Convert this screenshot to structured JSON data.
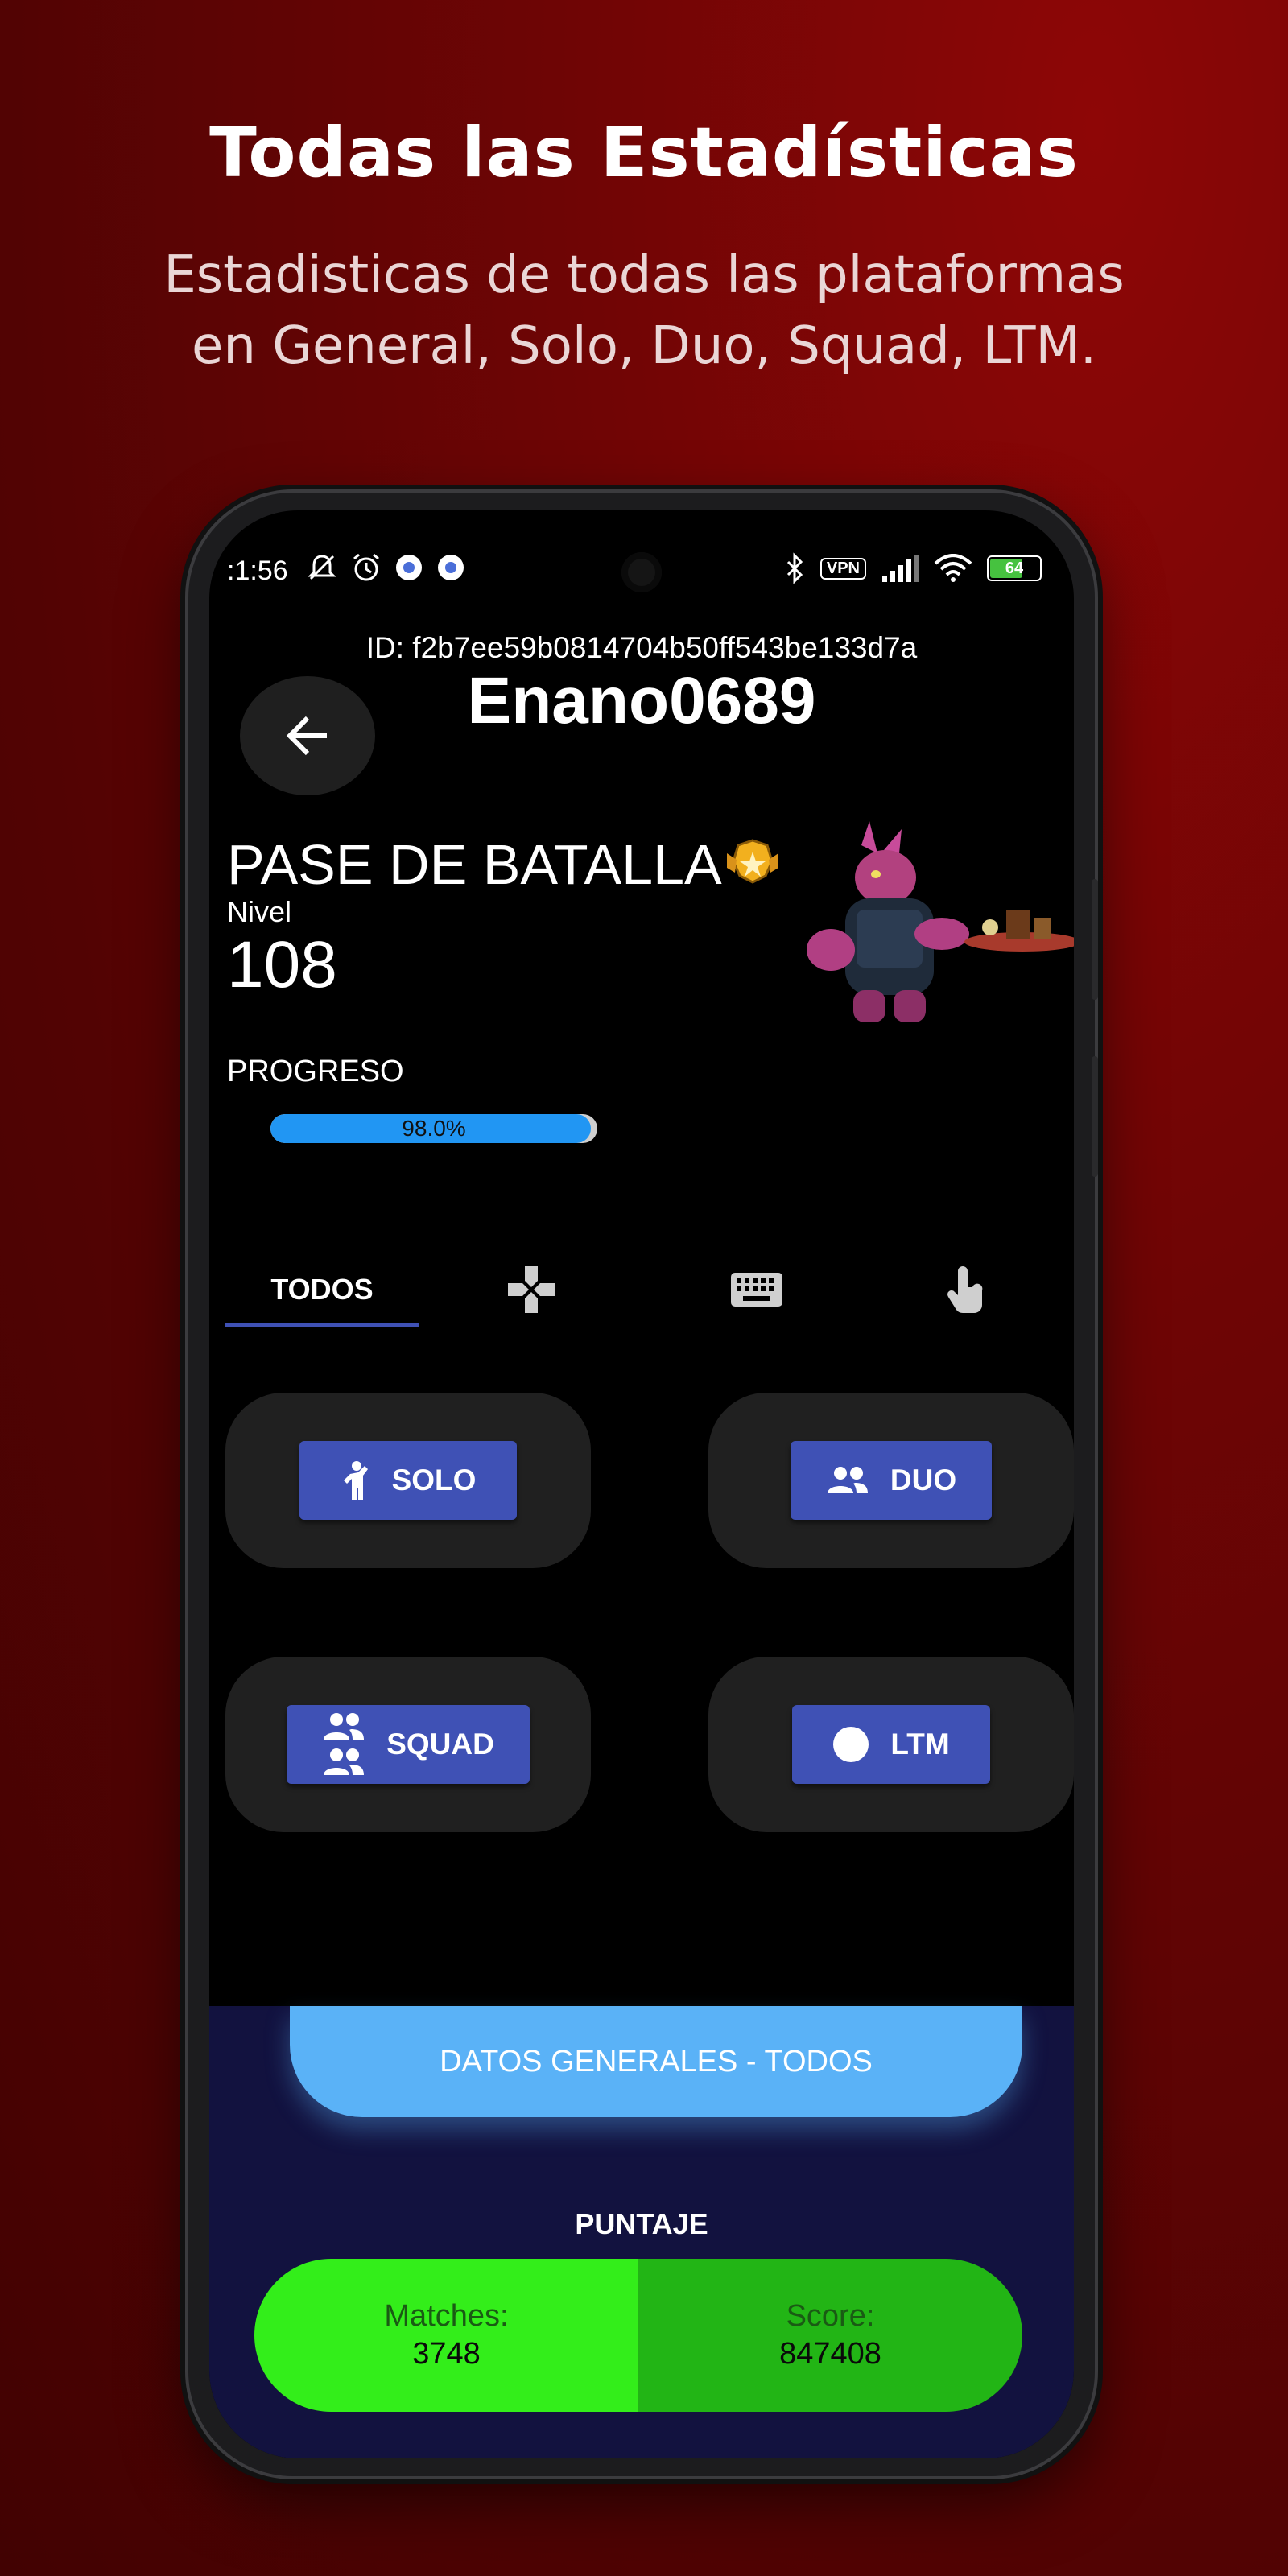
{
  "promo": {
    "title": "Todas las Estadísticas",
    "subtitle_line1": "Estadisticas de todas las plataformas",
    "subtitle_line2": "en General, Solo, Duo, Squad, LTM."
  },
  "status_bar": {
    "time": ":1:56",
    "vpn": "VPN",
    "battery": "64"
  },
  "profile": {
    "id_text": "ID: f2b7ee59b0814704b50ff543be133d7a",
    "username": "Enano0689"
  },
  "battle_pass": {
    "title": "PASE DE BATALLA",
    "level_label": "Nivel",
    "level": "108",
    "progress_label": "PROGRESO",
    "progress_text": "98.0%",
    "progress_fraction": 0.98
  },
  "tabs": [
    {
      "label": "TODOS",
      "icon": "all",
      "selected": true
    },
    {
      "label": "",
      "icon": "gamepad-icon"
    },
    {
      "label": "",
      "icon": "keyboard-icon"
    },
    {
      "label": "",
      "icon": "touch-icon"
    }
  ],
  "modes": {
    "solo": "SOLO",
    "duo": "DUO",
    "squad": "SQUAD",
    "ltm": "LTM"
  },
  "general": {
    "button": "DATOS GENERALES - TODOS",
    "section": "PUNTAJE",
    "matches_label": "Matches:",
    "matches_value": "3748",
    "score_label": "Score:",
    "score_value": "847408"
  },
  "colors": {
    "accent": "#3f51b5",
    "progress": "#2196f3",
    "general_button": "#5ab2f7",
    "matches_bg": "#33ee1a",
    "score_bg": "#22b515",
    "panel_bg": "#12123f"
  }
}
